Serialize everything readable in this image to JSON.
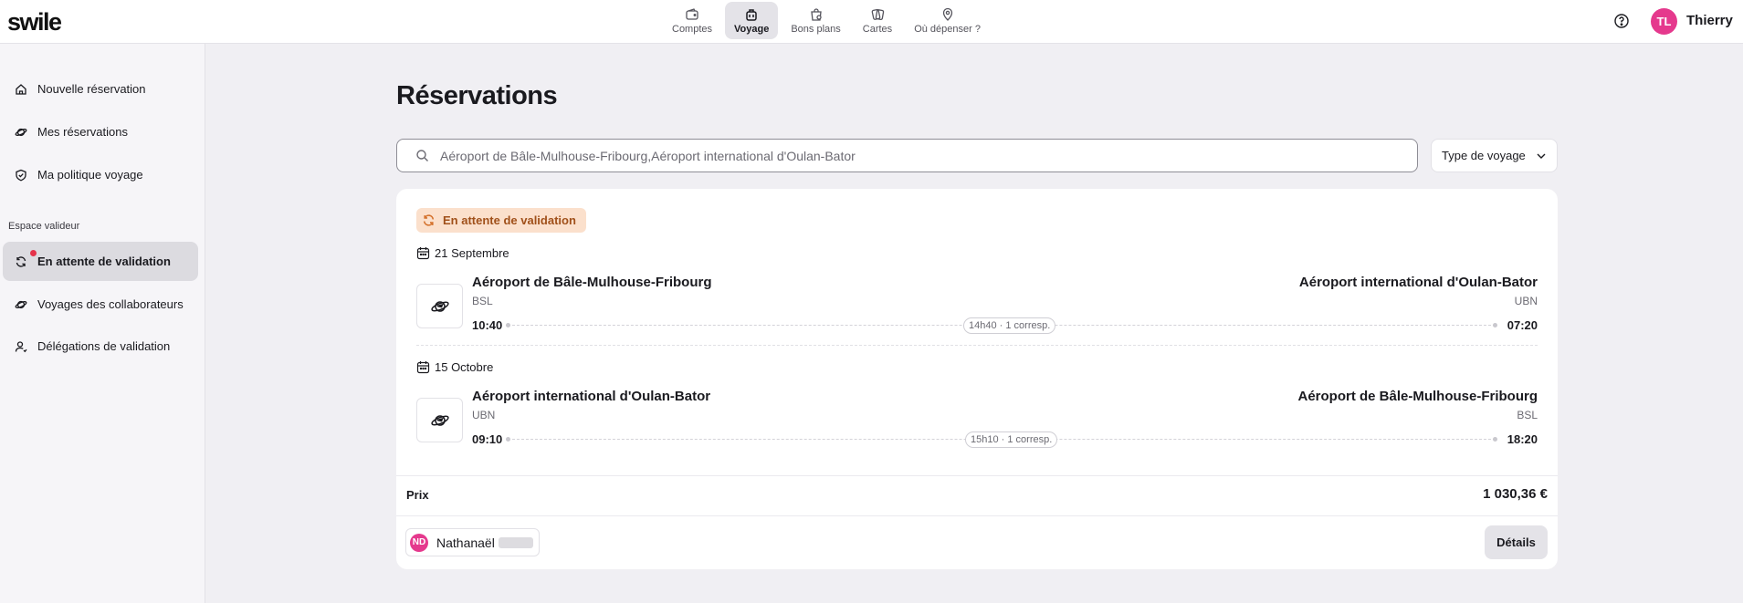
{
  "app": {
    "logo": "swile",
    "user": {
      "initials": "TL",
      "name": "Thierry"
    }
  },
  "nav": [
    {
      "label": "Comptes",
      "icon": "wallet-icon",
      "active": false
    },
    {
      "label": "Voyage",
      "icon": "luggage-icon",
      "active": true
    },
    {
      "label": "Bons plans",
      "icon": "shopping-bag-icon",
      "active": false
    },
    {
      "label": "Cartes",
      "icon": "cards-icon",
      "active": false
    },
    {
      "label": "Où dépenser ?",
      "icon": "map-pin-icon",
      "active": false
    }
  ],
  "sidebar": {
    "items": [
      {
        "label": "Nouvelle réservation",
        "icon": "home-icon"
      },
      {
        "label": "Mes réservations",
        "icon": "planet-icon"
      },
      {
        "label": "Ma politique voyage",
        "icon": "shield-check-icon"
      }
    ],
    "section_title": "Espace valideur",
    "validator_items": [
      {
        "label": "En attente de validation",
        "icon": "refresh-icon",
        "active": true,
        "notification": true
      },
      {
        "label": "Voyages des collaborateurs",
        "icon": "planet-icon"
      },
      {
        "label": "Délégations de validation",
        "icon": "user-icon"
      }
    ]
  },
  "main": {
    "title": "Réservations",
    "search": {
      "value": "Aéroport de Bâle-Mulhouse-Fribourg,Aéroport international d'Oulan-Bator"
    },
    "filter": {
      "label": "Type de voyage"
    }
  },
  "booking": {
    "status": "En attente de validation",
    "status_color": "#a0501a",
    "legs": [
      {
        "date": "21 Septembre",
        "from_name": "Aéroport de Bâle-Mulhouse-Fribourg",
        "from_code": "BSL",
        "to_name": "Aéroport international d'Oulan-Bator",
        "to_code": "UBN",
        "depart": "10:40",
        "arrive": "07:20",
        "duration": "14h40 · 1 corresp."
      },
      {
        "date": "15 Octobre",
        "from_name": "Aéroport international d'Oulan-Bator",
        "from_code": "UBN",
        "to_name": "Aéroport de Bâle-Mulhouse-Fribourg",
        "to_code": "BSL",
        "depart": "09:10",
        "arrive": "18:20",
        "duration": "15h10 · 1 corresp."
      }
    ],
    "price_label": "Prix",
    "price": "1 030,36 €",
    "traveler": {
      "initials": "ND",
      "name": "Nathanaël"
    },
    "details_label": "Détails"
  }
}
